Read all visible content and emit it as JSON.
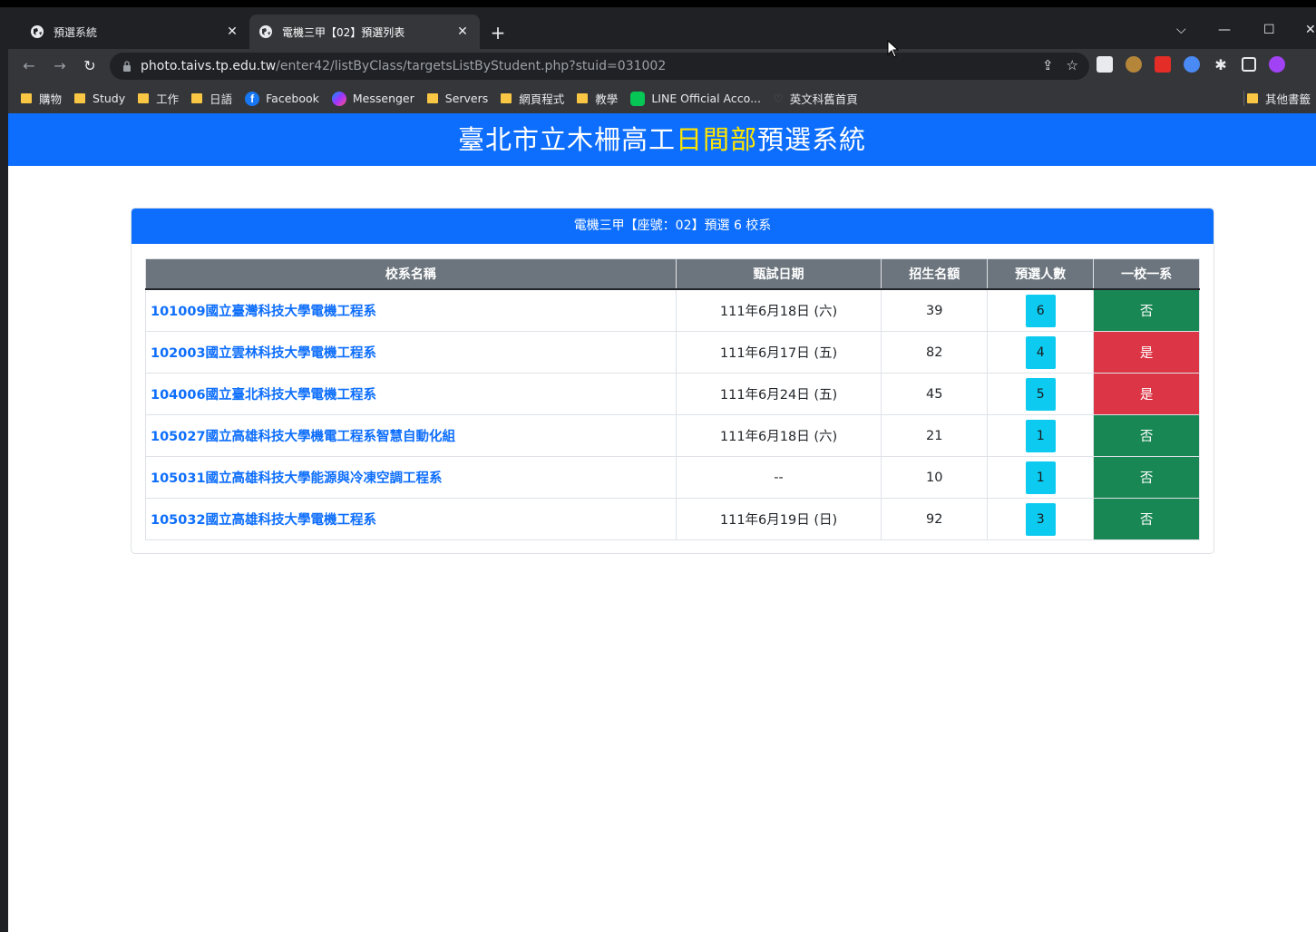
{
  "browser": {
    "tabs": [
      {
        "label": "預選系統",
        "active": false
      },
      {
        "label": "電機三甲【02】預選列表",
        "active": true
      }
    ],
    "url_host": "photo.taivs.tp.edu.tw",
    "url_path": "/enter42/listByClass/targetsListByStudent.php?stuid=031002",
    "bookmarks": [
      {
        "label": "購物",
        "icon": "folder-icon"
      },
      {
        "label": "Study",
        "icon": "folder-icon"
      },
      {
        "label": "工作",
        "icon": "folder-icon"
      },
      {
        "label": "日語",
        "icon": "folder-icon"
      },
      {
        "label": "Facebook",
        "icon": "facebook-icon"
      },
      {
        "label": "Messenger",
        "icon": "messenger-icon"
      },
      {
        "label": "Servers",
        "icon": "folder-icon"
      },
      {
        "label": "網頁程式",
        "icon": "folder-icon"
      },
      {
        "label": "教學",
        "icon": "folder-icon"
      },
      {
        "label": "LINE Official Acco...",
        "icon": "line-icon"
      },
      {
        "label": "英文科舊首頁",
        "icon": "heart-icon"
      }
    ],
    "other_bookmarks": "其他書籤"
  },
  "header": {
    "title_pre": "臺北市立木柵高工",
    "title_highlight": "日間部",
    "title_post": "預選系統",
    "highlight_color": "#ffe600",
    "bg_color": "#0d6efd"
  },
  "card": {
    "title": "電機三甲【座號：02】預選 6 校系"
  },
  "table": {
    "headers": [
      "校系名稱",
      "甄試日期",
      "招生名額",
      "預選人數",
      "一校一系"
    ],
    "rows": [
      {
        "name": "101009國立臺灣科技大學電機工程系",
        "date": "111年6月18日 (六)",
        "quota": "39",
        "count": "6",
        "one": "否",
        "one_status": "no"
      },
      {
        "name": "102003國立雲林科技大學電機工程系",
        "date": "111年6月17日 (五)",
        "quota": "82",
        "count": "4",
        "one": "是",
        "one_status": "yes"
      },
      {
        "name": "104006國立臺北科技大學電機工程系",
        "date": "111年6月24日 (五)",
        "quota": "45",
        "count": "5",
        "one": "是",
        "one_status": "yes"
      },
      {
        "name": "105027國立高雄科技大學機電工程系智慧自動化組",
        "date": "111年6月18日 (六)",
        "quota": "21",
        "count": "1",
        "one": "否",
        "one_status": "no"
      },
      {
        "name": "105031國立高雄科技大學能源與冷凍空調工程系",
        "date": "--",
        "quota": "10",
        "count": "1",
        "one": "否",
        "one_status": "no"
      },
      {
        "name": "105032國立高雄科技大學電機工程系",
        "date": "111年6月19日 (日)",
        "quota": "92",
        "count": "3",
        "one": "否",
        "one_status": "no"
      }
    ]
  }
}
